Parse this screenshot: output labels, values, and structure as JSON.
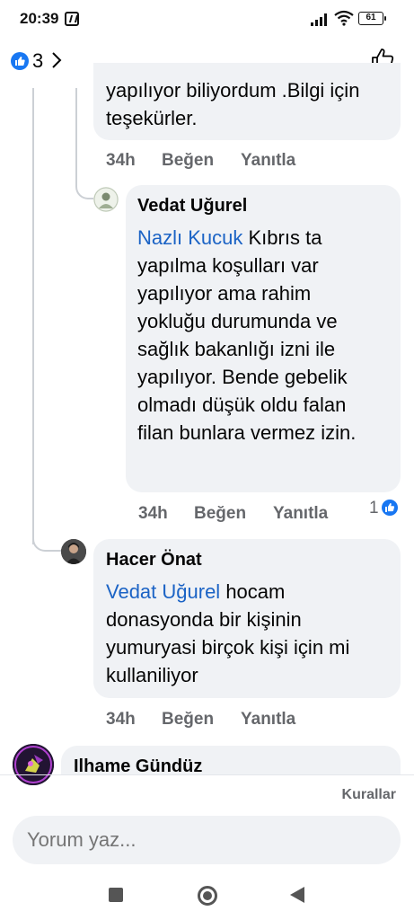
{
  "status_bar": {
    "time": "20:39",
    "battery": "61"
  },
  "reaction_header": {
    "count": "3"
  },
  "comments": [
    {
      "text": "yapılıyor biliyordum .Bilgi için teşekürler.",
      "time": "34h",
      "like_label": "Beğen",
      "reply_label": "Yanıtla"
    },
    {
      "author": "Vedat Uğurel",
      "mention": "Nazlı Kucuk",
      "text": " Kıbrıs ta yapılma koşulları var yapılıyor ama rahim yokluğu durumunda ve sağlık bakanlığı izni ile yapılıyor. Bende gebelik olmadı düşük oldu falan filan bunlara vermez izin.",
      "time": "34h",
      "like_label": "Beğen",
      "reply_label": "Yanıtla",
      "like_count": "1"
    },
    {
      "author": "Hacer Önat",
      "mention": "Vedat Uğurel",
      "text": " hocam donasyonda bir kişinin yumuryasi birçok kişi için mi kullaniliyor",
      "time": "34h",
      "like_label": "Beğen",
      "reply_label": "Yanıtla"
    },
    {
      "author": "Ilhame Gündüz"
    }
  ],
  "footer": {
    "rules_label": "Kurallar",
    "input_placeholder": "Yorum yaz..."
  },
  "colors": {
    "accent": "#1877f2",
    "mention": "#1b63c5",
    "bubble": "#f0f2f5",
    "muted": "#65676b"
  }
}
